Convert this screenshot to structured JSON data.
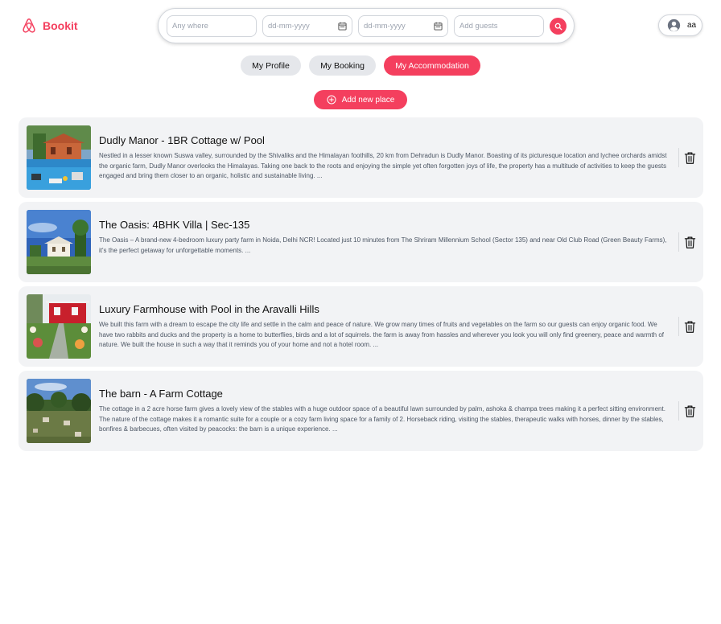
{
  "brand": {
    "name": "Bookit",
    "logo_icon": "airbnb-logo-icon",
    "accent_color": "#f43f5e"
  },
  "search": {
    "where_placeholder": "Any where",
    "checkin_placeholder": "dd-mm-yyyy",
    "checkout_placeholder": "dd-mm-yyyy",
    "guests_placeholder": "Add guests",
    "calendar_icon": "calendar-icon",
    "search_icon": "search-icon"
  },
  "user": {
    "name": "aa",
    "avatar_icon": "user-circle-icon"
  },
  "tabs": [
    {
      "label": "My Profile",
      "active": false
    },
    {
      "label": "My Booking",
      "active": false
    },
    {
      "label": "My Accommodation",
      "active": true
    }
  ],
  "add_button": {
    "label": "Add new place",
    "icon": "plus-circle-icon"
  },
  "places": [
    {
      "title": "Dudly Manor - 1BR Cottage w/ Pool",
      "description": "Nestled in a lesser known Suswa valley, surrounded by the Shivaliks and the Himalayan foothills, 20 km from Dehradun is Dudly Manor. Boasting of its picturesque location and lychee orchards amidst the organic farm, Dudly Manor overlooks the Himalayas. Taking one back to the roots and enjoying the simple yet often forgotten joys of life, the property has a multitude of activities to keep the guests engaged and bring them closer to an organic, holistic and sustainable living. ..."
    },
    {
      "title": "The Oasis: 4BHK Villa | Sec-135",
      "description": "The Oasis – A brand-new 4-bedroom luxury party farm in Noida, Delhi NCR! Located just 10 minutes from The Shriram Millennium School (Sector 135) and near Old Club Road (Green Beauty Farms), it's the perfect getaway for unforgettable moments. ..."
    },
    {
      "title": "Luxury Farmhouse with Pool in the Aravalli Hills",
      "description": "We built this farm with a dream to escape the city life and settle in the calm and peace of nature. We grow many times of fruits and vegetables on the farm so our guests can enjoy organic food. We have two rabbits and ducks and the property is a home to butterflies, birds and a lot of squirrels. the farm is away from hassles and wherever you look you will only find greenery, peace and warmth of nature. We built the house in such a way that it reminds you of your home and not a hotel room. ..."
    },
    {
      "title": "The barn - A Farm Cottage",
      "description": "The cottage in a 2 acre horse farm gives a lovely view of the stables with a huge outdoor space of a beautiful lawn surrounded by palm, ashoka & champa trees making it a perfect sitting environment. The nature of the cottage makes it a romantic suite for a couple or a cozy farm living space for a family of 2. Horseback riding, visiting the stables, therapeutic walks with horses, dinner by the stables, bonfires & barbecues, often visited by peacocks: the barn is a unique experience. ..."
    }
  ],
  "delete_icon": "trash-icon"
}
